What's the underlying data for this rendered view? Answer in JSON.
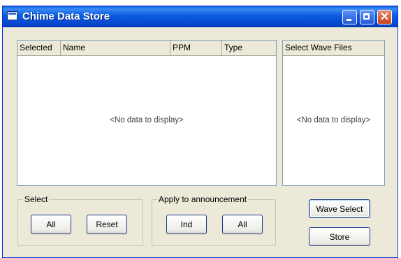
{
  "window": {
    "title": "Chime Data Store",
    "controls": {
      "minimize": "minimize",
      "maximize": "maximize",
      "close": "✕"
    }
  },
  "main_grid": {
    "columns": [
      "Selected",
      "Name",
      "PPM",
      "Type"
    ],
    "empty_text": "<No data to display>"
  },
  "wave_grid": {
    "columns": [
      "Select Wave Files"
    ],
    "empty_text": "<No data to display>"
  },
  "select_group": {
    "label": "Select",
    "all_button": "All",
    "reset_button": "Reset"
  },
  "apply_group": {
    "label": "Apply to announcement",
    "ind_button": "Ind",
    "all_button": "All"
  },
  "actions": {
    "wave_select_button": "Wave Select",
    "store_button": "Store"
  },
  "colors": {
    "titlebar": "#0846cc",
    "window_bg": "#ece9d8",
    "panel_border": "#7f9db9",
    "close_button": "#c8421c"
  }
}
